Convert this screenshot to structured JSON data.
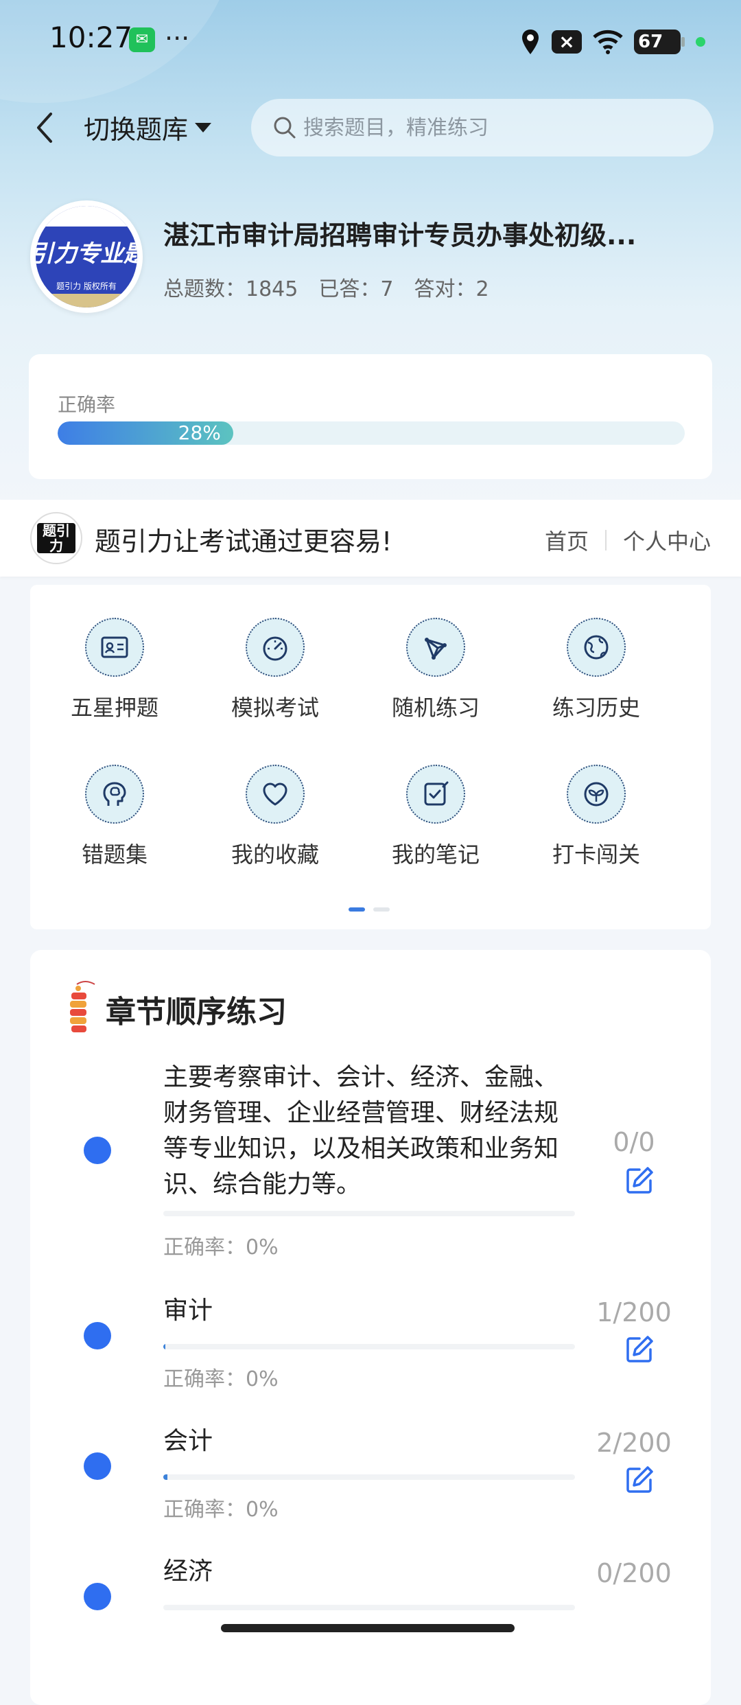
{
  "status_bar": {
    "time": "10:27",
    "dots": "···",
    "battery": "67"
  },
  "header": {
    "switch_label": "切换题库",
    "search_placeholder": "搜索题目，精准练习"
  },
  "bank": {
    "logo_text": "引力专业题",
    "logo_small": "题引力 版权所有",
    "title": "湛江市审计局招聘审计专员办事处初级...",
    "stats": {
      "total": "总题数：1845",
      "answered": "已答：7",
      "correct": "答对：2"
    }
  },
  "accuracy": {
    "label": "正确率",
    "value": "28%",
    "fraction": 0.28
  },
  "banner": {
    "logo_text": "题引力",
    "slogan": "题引力让考试通过更容易!",
    "home": "首页",
    "profile": "个人中心"
  },
  "menu": [
    {
      "label": "五星押题",
      "icon": "id-card-icon"
    },
    {
      "label": "模拟考试",
      "icon": "speedometer-icon"
    },
    {
      "label": "随机练习",
      "icon": "network-icon"
    },
    {
      "label": "练习历史",
      "icon": "globe-icon"
    },
    {
      "label": "错题集",
      "icon": "brain-head-icon"
    },
    {
      "label": "我的收藏",
      "icon": "heart-icon"
    },
    {
      "label": "我的笔记",
      "icon": "note-check-icon"
    },
    {
      "label": "打卡闯关",
      "icon": "sprout-icon"
    }
  ],
  "chapters": {
    "title": "章节顺序练习",
    "items": [
      {
        "name": "主要考察审计、会计、经济、金融、财务管理、企业经营管理、财经法规等专业知识，以及相关政策和业务知识、综合能力等。",
        "rate": "正确率：0%",
        "count": "0/0",
        "progress": 0
      },
      {
        "name": "审计",
        "rate": "正确率：0%",
        "count": "1/200",
        "progress": 0.005
      },
      {
        "name": "会计",
        "rate": "正确率：0%",
        "count": "2/200",
        "progress": 0.01
      },
      {
        "name": "经济",
        "rate": "",
        "count": "0/200",
        "progress": 0
      }
    ]
  },
  "colors": {
    "accent": "#2f6ef0",
    "progress_start": "#3e7ee6",
    "progress_end": "#5cc3c0"
  }
}
